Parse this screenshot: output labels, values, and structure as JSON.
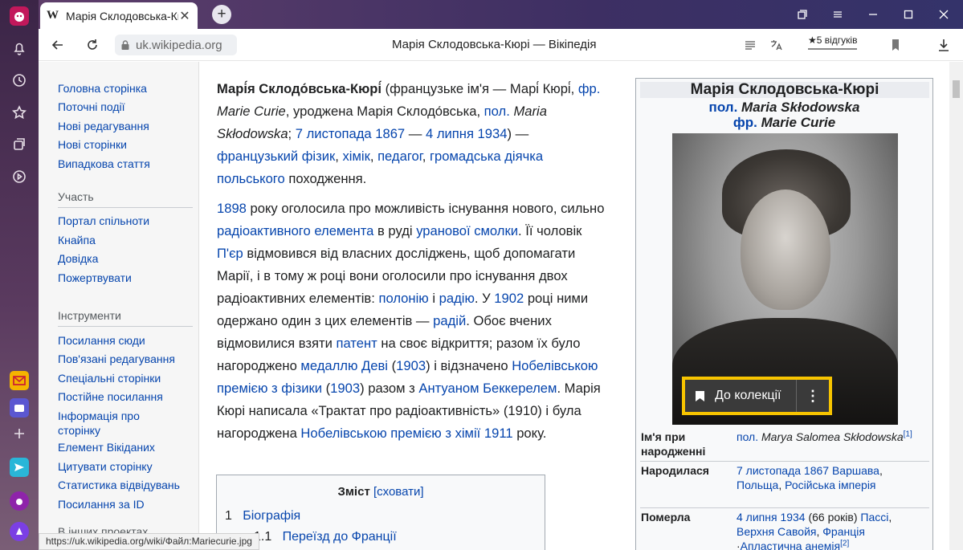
{
  "browser": {
    "tab_logo": "W",
    "tab_title": "Марія Склодовська-Кюрі",
    "url": "uk.wikipedia.org",
    "page_title": "Марія Склодовська-Кюрі — Вікіпедія",
    "reviews": "★5 відгуків",
    "status_url": "https://uk.wikipedia.org/wiki/Файл:Mariecurie.jpg"
  },
  "nav": {
    "main": [
      "Головна сторінка",
      "Поточні події",
      "Нові редагування",
      "Нові сторінки",
      "Випадкова стаття"
    ],
    "participation_heading": "Участь",
    "participation": [
      "Портал спільноти",
      "Кнайпа",
      "Довідка",
      "Пожертвувати"
    ],
    "tools_heading": "Інструменти",
    "tools": [
      "Посилання сюди",
      "Пов'язані редагування",
      "Спеціальні сторінки",
      "Постійне посилання",
      "Інформація про сторінку",
      "Елемент Вікіданих",
      "Цитувати сторінку",
      "Статистика відвідувань",
      "Посилання за ID"
    ],
    "other_projects": "В інших проектах"
  },
  "article": {
    "p1": [
      {
        "t": "Марі́я Склодо́вська-Кюрі́",
        "b": true
      },
      {
        "t": " (французьке ім'я — Марі́ Кюрі́, "
      },
      {
        "t": "фр.",
        "l": true
      },
      {
        "t": " "
      },
      {
        "t": "Marie Curie",
        "i": true
      },
      {
        "t": ", уроджена Марія Склодо́вська, "
      },
      {
        "t": "пол.",
        "l": true
      },
      {
        "t": " "
      },
      {
        "t": "Maria Skłodowska",
        "i": true
      },
      {
        "t": "; "
      },
      {
        "t": "7 листопада 1867",
        "l": true
      },
      {
        "t": " — "
      },
      {
        "t": "4 липня 1934",
        "l": true
      },
      {
        "t": ") — "
      },
      {
        "t": "французький",
        "l": true
      },
      {
        "t": " "
      },
      {
        "t": "фізик",
        "l": true
      },
      {
        "t": ", "
      },
      {
        "t": "хімік",
        "l": true
      },
      {
        "t": ", "
      },
      {
        "t": "педагог",
        "l": true
      },
      {
        "t": ", "
      },
      {
        "t": "громадська діячка",
        "l": true
      },
      {
        "t": " "
      },
      {
        "t": "польського",
        "l": true
      },
      {
        "t": " походження."
      }
    ],
    "p2": [
      {
        "t": "1898",
        "l": true
      },
      {
        "t": " року оголосила про можливість існування нового, сильно "
      },
      {
        "t": "радіоактивного елемента",
        "l": true
      },
      {
        "t": " в руді "
      },
      {
        "t": "уранової смолки",
        "l": true
      },
      {
        "t": ". Її чоловік "
      },
      {
        "t": "П'єр",
        "l": true
      },
      {
        "t": " відмовився від власних досліджень, щоб допомагати Марії, і в тому ж році вони оголосили про існування двох радіоактивних елементів: "
      },
      {
        "t": "полонію",
        "l": true
      },
      {
        "t": " і "
      },
      {
        "t": "радію",
        "l": true
      },
      {
        "t": ". У "
      },
      {
        "t": "1902",
        "l": true
      },
      {
        "t": " році ними одержано один з цих елементів — "
      },
      {
        "t": "радій",
        "l": true
      },
      {
        "t": ". Обоє вчених відмовилися взяти "
      },
      {
        "t": "патент",
        "l": true
      },
      {
        "t": " на своє відкриття; разом їх було нагороджено "
      },
      {
        "t": "медаллю Деві",
        "l": true
      },
      {
        "t": " ("
      },
      {
        "t": "1903",
        "l": true
      },
      {
        "t": ") і відзначено "
      },
      {
        "t": "Нобелівською премією з фізики",
        "l": true
      },
      {
        "t": " ("
      },
      {
        "t": "1903",
        "l": true
      },
      {
        "t": ") разом з "
      },
      {
        "t": "Антуаном Беккерелем",
        "l": true
      },
      {
        "t": ". Марія Кюрі написала «Трактат про радіоактивність» (1910) і була нагороджена "
      },
      {
        "t": "Нобелівською премією з хімії",
        "l": true
      },
      {
        "t": " "
      },
      {
        "t": "1911",
        "l": true
      },
      {
        "t": " року."
      }
    ]
  },
  "toc": {
    "title": "Зміст",
    "hide": "[сховати]",
    "items": [
      {
        "num": "1",
        "label": "Біографія"
      },
      {
        "num": "1.1",
        "label": "Переїзд до Франції"
      }
    ]
  },
  "infobox": {
    "title": "Марія Склодовська-Кюрі",
    "sub1_lang": "пол.",
    "sub1_name": "Maria Skłodowska",
    "sub2_lang": "фр.",
    "sub2_name": "Marie Curie",
    "collection_button": "До колекції",
    "rows": [
      {
        "key": "Ім'я при народженні",
        "val": [
          {
            "t": "пол.",
            "l": true
          },
          {
            "t": " "
          },
          {
            "t": "Marya Salomea Skłodowska",
            "i": true
          },
          {
            "t": "[1]",
            "sup": true
          }
        ]
      },
      {
        "key": "Народилася",
        "val": [
          {
            "t": "7 листопада 1867",
            "l": true
          },
          {
            "t": " "
          },
          {
            "t": "Варшава",
            "l": true
          },
          {
            "t": ", "
          },
          {
            "t": "Польща",
            "l": true
          },
          {
            "t": ", "
          },
          {
            "t": "Російська імперія",
            "l": true
          }
        ]
      },
      {
        "key": "Померла",
        "val": [
          {
            "t": "4 липня 1934",
            "l": true
          },
          {
            "t": " (66 років) "
          },
          {
            "t": "Пассі",
            "l": true
          },
          {
            "t": ", "
          },
          {
            "t": "Верхня Савойя",
            "l": true
          },
          {
            "t": ", "
          },
          {
            "t": "Франція",
            "l": true
          },
          {
            "t": " ·"
          },
          {
            "t": "Апластична анемія",
            "l": true
          },
          {
            "t": "[2]",
            "sup": true
          }
        ]
      }
    ]
  },
  "colors": {
    "link": "#0645ad",
    "text": "#202122",
    "sidebar_top": "#3b2547",
    "tab_bar": "#3d2f63",
    "collection_outline": "#f7c400"
  }
}
